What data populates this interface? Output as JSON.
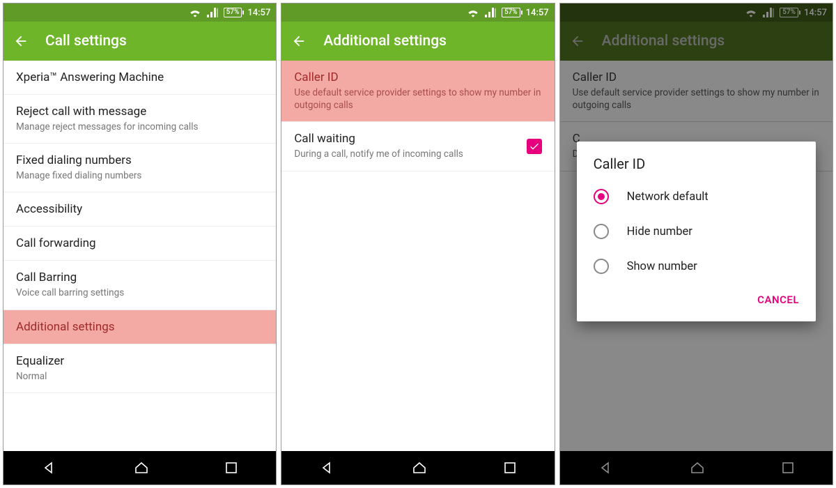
{
  "status": {
    "battery": "57%",
    "time": "14:57"
  },
  "screens": [
    {
      "title": "Call settings",
      "items": [
        {
          "primary": "Xperia™ Answering Machine",
          "secondary": ""
        },
        {
          "primary": "Reject call with message",
          "secondary": "Manage reject messages for incoming calls"
        },
        {
          "primary": "Fixed dialing numbers",
          "secondary": "Manage fixed dialing numbers"
        },
        {
          "primary": "Accessibility",
          "secondary": ""
        },
        {
          "primary": "Call forwarding",
          "secondary": ""
        },
        {
          "primary": "Call Barring",
          "secondary": "Voice call barring settings"
        },
        {
          "primary": "Additional settings",
          "secondary": "",
          "highlight": true
        },
        {
          "primary": "Equalizer",
          "secondary": "Normal"
        }
      ]
    },
    {
      "title": "Additional settings",
      "items": [
        {
          "primary": "Caller ID",
          "secondary": "Use default service provider settings to show my number in outgoing calls",
          "highlight": true
        },
        {
          "primary": "Call waiting",
          "secondary": "During a call, notify me of incoming calls",
          "checked": true
        }
      ]
    },
    {
      "title": "Additional settings",
      "behind_items": [
        {
          "primary": "Caller ID",
          "secondary": "Use default service provider settings to show my number in outgoing calls"
        },
        {
          "primary": "C",
          "secondary": "D"
        }
      ],
      "dialog": {
        "title": "Caller ID",
        "options": [
          {
            "label": "Network default",
            "selected": true
          },
          {
            "label": "Hide number",
            "selected": false
          },
          {
            "label": "Show number",
            "selected": false
          }
        ],
        "cancel": "CANCEL"
      }
    }
  ]
}
